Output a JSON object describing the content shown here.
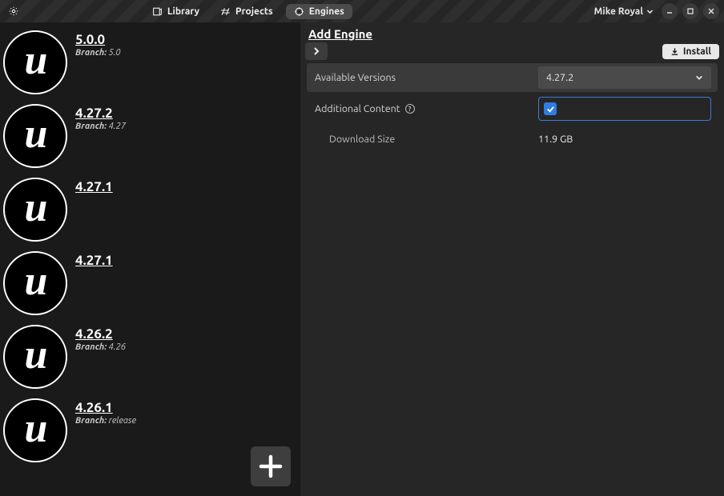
{
  "header": {
    "tabs": [
      {
        "label": "Library",
        "active": false
      },
      {
        "label": "Projects",
        "active": false
      },
      {
        "label": "Engines",
        "active": true
      }
    ],
    "user": "Mike Royal"
  },
  "sidebar": {
    "engines": [
      {
        "version": "5.0.0",
        "branch": "5.0"
      },
      {
        "version": "4.27.2",
        "branch": "4.27"
      },
      {
        "version": "4.27.1",
        "branch": ""
      },
      {
        "version": "4.27.1",
        "branch": ""
      },
      {
        "version": "4.26.2",
        "branch": "4.26"
      },
      {
        "version": "4.26.1",
        "branch": "release"
      }
    ],
    "branch_label": "Branch:"
  },
  "main": {
    "title": "Add Engine",
    "install_label": "Install",
    "fields": {
      "available_versions_label": "Available Versions",
      "available_versions_value": "4.27.2",
      "additional_content_label": "Additional Content",
      "additional_content_checked": true,
      "download_size_label": "Download Size",
      "download_size_value": "11.9 GB"
    }
  }
}
